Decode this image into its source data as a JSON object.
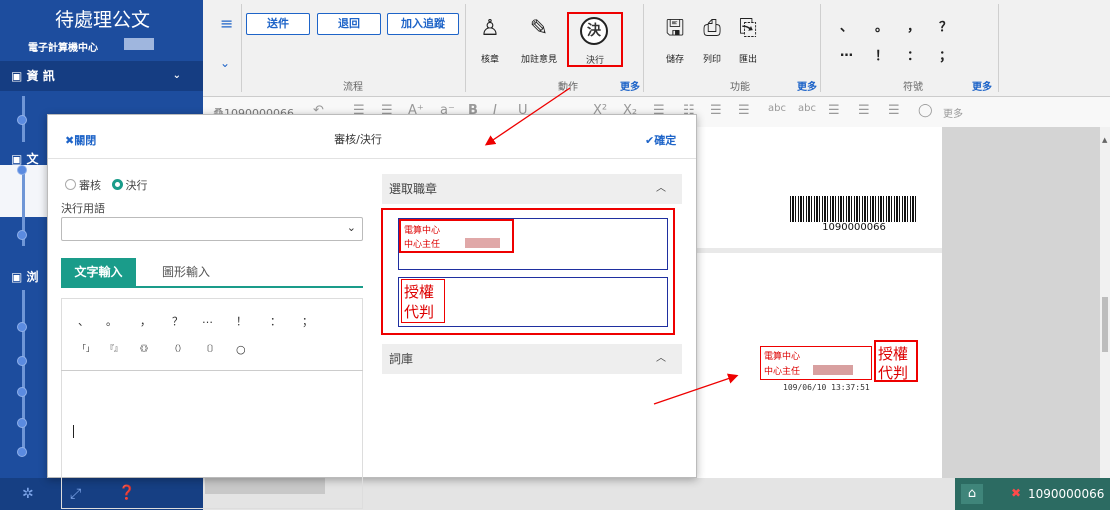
{
  "sidebar": {
    "title": "待處理公文",
    "subtitle": "電子計算機中心",
    "info_label": "資 訊",
    "info_chevron": "⌄",
    "sec2_label": "文",
    "sec3_label": "浏",
    "footer_icons": [
      "gear-icon",
      "expand-icon",
      "help-icon"
    ]
  },
  "toolbar": {
    "send": "送件",
    "return": "退回",
    "add_track": "加入追蹤",
    "flow_label": "流程",
    "action_label": "動作",
    "func_label": "功能",
    "symbol_label": "符號",
    "more": "更多",
    "seal": "核章",
    "comment": "加註意見",
    "decide": "決行",
    "save": "儲存",
    "print": "列印",
    "export": "匯出",
    "symbols_row1": [
      "、",
      "。",
      "，",
      "？"
    ],
    "symbols_row2": [
      "…",
      "！",
      "：",
      "；"
    ]
  },
  "format_bar": {
    "doc_no": "桑1090000066",
    "more": "更多"
  },
  "dialog": {
    "close": "✖關閉",
    "title": "審核/決行",
    "confirm": "✔確定",
    "radio_review": "審核",
    "radio_decide": "決行",
    "term_label": "決行用語",
    "tab_text": "文字輸入",
    "tab_graph": "圖形輸入",
    "symbols_row1": [
      "、",
      "。",
      "，",
      "？",
      "…",
      "！",
      "：",
      "；"
    ],
    "symbols_row2": [
      "「」",
      "『』",
      "《》",
      "（）",
      "〔〕",
      "○"
    ],
    "seal_section": "選取職章",
    "seal1_line1": "電算中心",
    "seal1_line2": "中心主任",
    "seal2_line1": "授權",
    "seal2_line2": "代判",
    "lexicon": "詞庫"
  },
  "document": {
    "barcode_number": "1090000066",
    "stamp_line1": "電算中心",
    "stamp_line2": "中心主任",
    "stamp_auth1": "授權",
    "stamp_auth2": "代判",
    "stamp_date": "109/06/10 13:37:51"
  },
  "dock": {
    "doc_id": "1090000066"
  },
  "colors": {
    "sidebar": "#1d4d9e",
    "accent": "#1e64c8",
    "teal": "#1a9c8a",
    "highlight": "#e00000"
  }
}
